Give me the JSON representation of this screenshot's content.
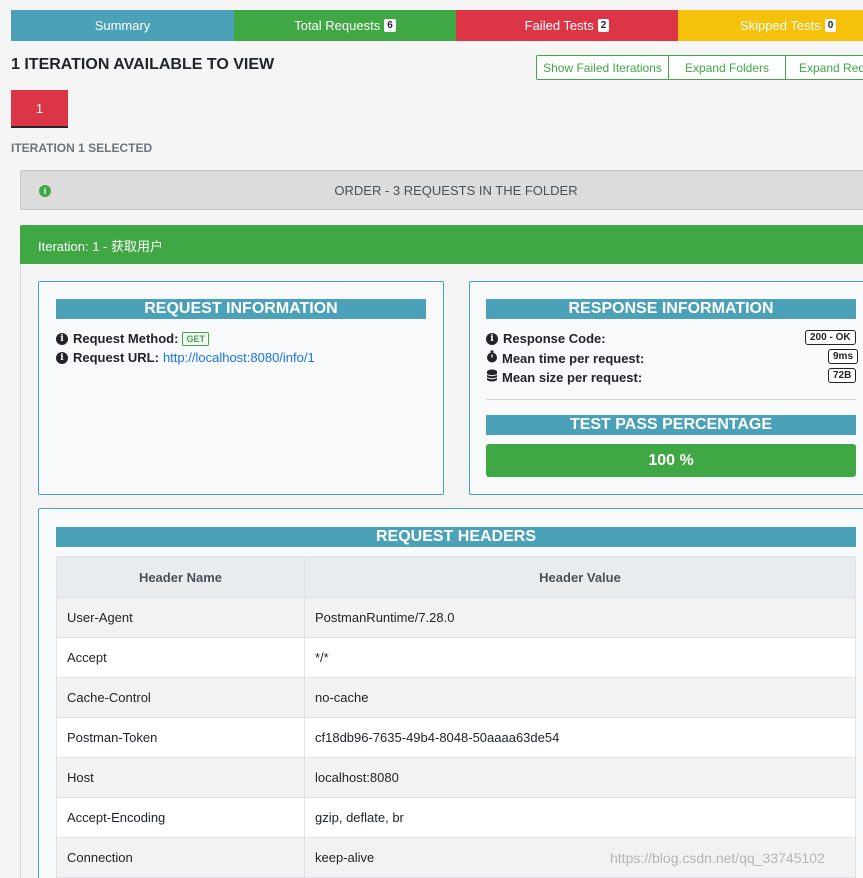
{
  "tabs": {
    "summary": "Summary",
    "total_requests": "Total Requests",
    "total_requests_count": "6",
    "failed_tests": "Failed Tests",
    "failed_tests_count": "2",
    "skipped_tests": "Skipped Tests",
    "skipped_tests_count": "0"
  },
  "iterations": {
    "title": "1 ITERATION AVAILABLE TO VIEW",
    "buttons": [
      "Show Failed Iterations",
      "Expand Folders",
      "Expand Requ"
    ],
    "current": "1",
    "selected_text": "ITERATION 1 SELECTED"
  },
  "folder": {
    "label": "ORDER - 3 REQUESTS IN THE FOLDER",
    "icon": "info-circle-icon"
  },
  "iteration_bar": {
    "label": "Iteration: 1 - 获取用户"
  },
  "request_info": {
    "title": "REQUEST INFORMATION",
    "method_label": "Request Method:",
    "method_value": "GET",
    "url_label": "Request URL:",
    "url_value": "http://localhost:8080/info/1"
  },
  "response_info": {
    "title": "RESPONSE INFORMATION",
    "code_label": "Response Code:",
    "code_value": "200 - OK",
    "time_label": "Mean time per request:",
    "time_value": "9ms",
    "size_label": "Mean size per request:",
    "size_value": "72B",
    "pass_title": "TEST PASS PERCENTAGE",
    "pass_value": "100 %"
  },
  "request_headers": {
    "title": "REQUEST HEADERS",
    "col_name": "Header Name",
    "col_value": "Header Value",
    "rows": [
      {
        "name": "User-Agent",
        "value": "PostmanRuntime/7.28.0"
      },
      {
        "name": "Accept",
        "value": "*/*"
      },
      {
        "name": "Cache-Control",
        "value": "no-cache"
      },
      {
        "name": "Postman-Token",
        "value": "cf18db96-7635-49b4-8048-50aaaa63de54"
      },
      {
        "name": "Host",
        "value": "localhost:8080"
      },
      {
        "name": "Accept-Encoding",
        "value": "gzip, deflate, br"
      },
      {
        "name": "Connection",
        "value": "keep-alive"
      }
    ]
  },
  "watermark": "https://blog.csdn.net/qq_33745102",
  "colors": {
    "info": "#4ba1b8",
    "success": "#40a745",
    "danger": "#dc3545",
    "warning": "#f5c10b"
  }
}
